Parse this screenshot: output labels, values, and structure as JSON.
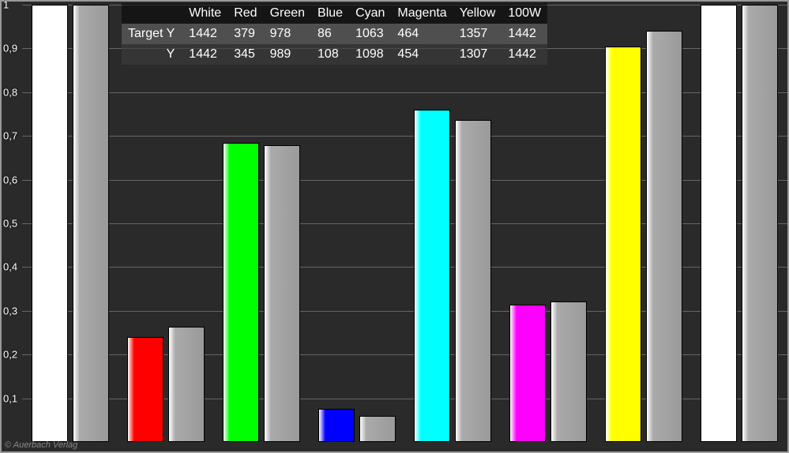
{
  "chart_data": {
    "type": "bar",
    "categories": [
      "White",
      "Red",
      "Green",
      "Blue",
      "Cyan",
      "Magenta",
      "Yellow",
      "100W"
    ],
    "series": [
      {
        "name": "Target Y",
        "values": [
          1442,
          379,
          978,
          86,
          1063,
          464,
          1357,
          1442
        ]
      },
      {
        "name": "Y",
        "values": [
          1442,
          345,
          989,
          108,
          1098,
          454,
          1307,
          1442
        ]
      }
    ],
    "ylim": [
      0,
      1
    ],
    "y_ticks": [
      "1",
      "0,9",
      "0,8",
      "0,7",
      "0,6",
      "0,5",
      "0,4",
      "0,3",
      "0,2",
      "0,1"
    ],
    "bar_plot_values": {
      "comment": "normalized heights shown on plot (0..1)",
      "series_a": [
        1.0,
        0.24,
        0.685,
        0.075,
        0.76,
        0.315,
        0.905,
        1.0
      ],
      "series_b": [
        1.0,
        0.263,
        0.678,
        0.06,
        0.737,
        0.322,
        0.94,
        1.0
      ]
    },
    "colors": {
      "White": "#ffffff",
      "Red": "#ff0000",
      "Green": "#00ff00",
      "Blue": "#0000ff",
      "Cyan": "#00ffff",
      "Magenta": "#ff00ff",
      "Yellow": "#ffff00",
      "100W": "#ffffff",
      "comparison": "#aaaaaa"
    }
  },
  "table": {
    "columns": [
      "",
      "White",
      "Red",
      "Green",
      "Blue",
      "Cyan",
      "Magenta",
      "Yellow",
      "100W"
    ],
    "rows": [
      {
        "label": "Target Y",
        "cells": [
          "1442",
          "379",
          "978",
          "86",
          "1063",
          "464",
          "1357",
          "1442"
        ]
      },
      {
        "label": "Y",
        "cells": [
          "1442",
          "345",
          "989",
          "108",
          "1098",
          "454",
          "1307",
          "1442"
        ]
      }
    ]
  },
  "copyright": "© Auerbach Verlag"
}
